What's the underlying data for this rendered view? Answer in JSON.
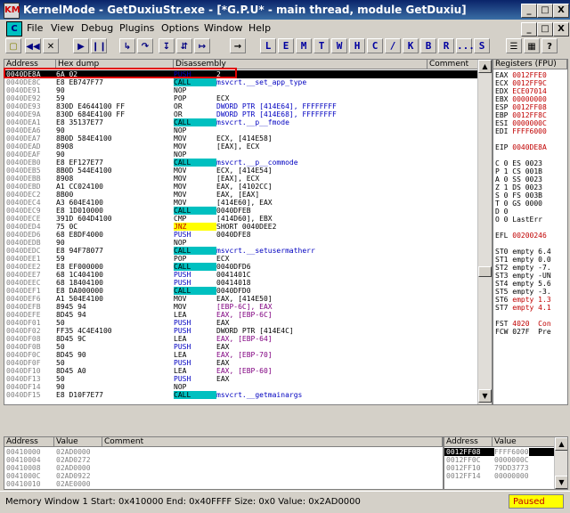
{
  "title": "KernelMode - GetDuxiuStr.exe - [*G.P.U* - main thread, module GetDuxiu]",
  "title_icon": "KM",
  "window_buttons": [
    "_",
    "□",
    "X"
  ],
  "inner_buttons": [
    "_",
    "□",
    "X"
  ],
  "menu": [
    "File",
    "View",
    "Debug",
    "Plugins",
    "Options",
    "Window",
    "Help"
  ],
  "menu_icon": "C",
  "toolbar_letters": [
    "L",
    "E",
    "M",
    "T",
    "W",
    "H",
    "C",
    "/",
    "K",
    "B",
    "R",
    "...",
    "S"
  ],
  "disasm_headers": {
    "address": "Address",
    "hex": "Hex dump",
    "disasm": "Disassembly",
    "comment": "Comment"
  },
  "disasm_rows": [
    {
      "addr": "0040DE8A",
      "hex": "6A 02",
      "op": "PUSH",
      "arg": "2",
      "kind": "push",
      "sel": true
    },
    {
      "addr": "0040DE8C",
      "hex": "E8 EB747F77",
      "op": "CALL",
      "arg": "msvcrt.__set_app_type",
      "kind": "call"
    },
    {
      "addr": "0040DE91",
      "hex": "90",
      "op": "NOP",
      "arg": "",
      "kind": ""
    },
    {
      "addr": "0040DE92",
      "hex": "59",
      "op": "POP",
      "arg": "ECX",
      "kind": ""
    },
    {
      "addr": "0040DE93",
      "hex": "830D E4644100 FF",
      "op": "OR",
      "arg": "DWORD PTR [414E64], FFFFFFFF",
      "kind": ""
    },
    {
      "addr": "0040DE9A",
      "hex": "830D 684E4100 FF",
      "op": "OR",
      "arg": "DWORD PTR [414E68], FFFFFFFF",
      "kind": ""
    },
    {
      "addr": "0040DEA1",
      "hex": "E8 35137E77",
      "op": "CALL",
      "arg": "msvcrt.__p__fmode",
      "kind": "call"
    },
    {
      "addr": "0040DEA6",
      "hex": "90",
      "op": "NOP",
      "arg": "",
      "kind": ""
    },
    {
      "addr": "0040DEA7",
      "hex": "8B0D 584E4100",
      "op": "MOV",
      "arg": "ECX, [414E58]",
      "kind": ""
    },
    {
      "addr": "0040DEAD",
      "hex": "8908",
      "op": "MOV",
      "arg": "[EAX], ECX",
      "kind": ""
    },
    {
      "addr": "0040DEAF",
      "hex": "90",
      "op": "NOP",
      "arg": "",
      "kind": ""
    },
    {
      "addr": "0040DEB0",
      "hex": "E8 EF127E77",
      "op": "CALL",
      "arg": "msvcrt.__p__commode",
      "kind": "call"
    },
    {
      "addr": "0040DEB5",
      "hex": "8B0D 544E4100",
      "op": "MOV",
      "arg": "ECX, [414E54]",
      "kind": ""
    },
    {
      "addr": "0040DEBB",
      "hex": "8908",
      "op": "MOV",
      "arg": "[EAX], ECX",
      "kind": ""
    },
    {
      "addr": "0040DEBD",
      "hex": "A1 CC024100",
      "op": "MOV",
      "arg": "EAX, [4102CC]",
      "kind": ""
    },
    {
      "addr": "0040DEC2",
      "hex": "8B00",
      "op": "MOV",
      "arg": "EAX, [EAX]",
      "kind": ""
    },
    {
      "addr": "0040DEC4",
      "hex": "A3 604E4100",
      "op": "MOV",
      "arg": "[414E60], EAX",
      "kind": ""
    },
    {
      "addr": "0040DEC9",
      "hex": "E8 1D010000",
      "op": "CALL",
      "arg": "0040DFEB",
      "kind": "call"
    },
    {
      "addr": "0040DECE",
      "hex": "391D 604D4100",
      "op": "CMP",
      "arg": "[414D60], EBX",
      "kind": ""
    },
    {
      "addr": "0040DED4",
      "hex": "75 0C",
      "op": "JNZ",
      "arg": "SHORT 0040DEE2",
      "kind": "jmp"
    },
    {
      "addr": "0040DED6",
      "hex": "68 E8DF4000",
      "op": "PUSH",
      "arg": "0040DFE8",
      "kind": "push"
    },
    {
      "addr": "0040DEDB",
      "hex": "90",
      "op": "NOP",
      "arg": "",
      "kind": ""
    },
    {
      "addr": "0040DEDC",
      "hex": "E8 94F78077",
      "op": "CALL",
      "arg": "msvcrt.__setusermatherr",
      "kind": "call"
    },
    {
      "addr": "0040DEE1",
      "hex": "59",
      "op": "POP",
      "arg": "ECX",
      "kind": ""
    },
    {
      "addr": "0040DEE2",
      "hex": "E8 EF000000",
      "op": "CALL",
      "arg": "0040DFD6",
      "kind": "call"
    },
    {
      "addr": "0040DEE7",
      "hex": "68 1C404100",
      "op": "PUSH",
      "arg": "0041401C",
      "kind": "push"
    },
    {
      "addr": "0040DEEC",
      "hex": "68 18404100",
      "op": "PUSH",
      "arg": "00414018",
      "kind": "push"
    },
    {
      "addr": "0040DEF1",
      "hex": "E8 DA000000",
      "op": "CALL",
      "arg": "0040DFD0",
      "kind": "call"
    },
    {
      "addr": "0040DEF6",
      "hex": "A1 504E4100",
      "op": "MOV",
      "arg": "EAX, [414E50]",
      "kind": ""
    },
    {
      "addr": "0040DEFB",
      "hex": "8945 94",
      "op": "MOV",
      "arg": "[EBP-6C], EAX",
      "kind": ""
    },
    {
      "addr": "0040DEFE",
      "hex": "8D45 94",
      "op": "LEA",
      "arg": "EAX, [EBP-6C]",
      "kind": ""
    },
    {
      "addr": "0040DF01",
      "hex": "50",
      "op": "PUSH",
      "arg": "EAX",
      "kind": "push"
    },
    {
      "addr": "0040DF02",
      "hex": "FF35 4C4E4100",
      "op": "PUSH",
      "arg": "DWORD PTR [414E4C]",
      "kind": "push"
    },
    {
      "addr": "0040DF08",
      "hex": "8D45 9C",
      "op": "LEA",
      "arg": "EAX, [EBP-64]",
      "kind": ""
    },
    {
      "addr": "0040DF0B",
      "hex": "50",
      "op": "PUSH",
      "arg": "EAX",
      "kind": "push"
    },
    {
      "addr": "0040DF0C",
      "hex": "8D45 90",
      "op": "LEA",
      "arg": "EAX, [EBP-70]",
      "kind": ""
    },
    {
      "addr": "0040DF0F",
      "hex": "50",
      "op": "PUSH",
      "arg": "EAX",
      "kind": "push"
    },
    {
      "addr": "0040DF10",
      "hex": "8D45 A0",
      "op": "LEA",
      "arg": "EAX, [EBP-60]",
      "kind": ""
    },
    {
      "addr": "0040DF13",
      "hex": "50",
      "op": "PUSH",
      "arg": "EAX",
      "kind": "push"
    },
    {
      "addr": "0040DF14",
      "hex": "90",
      "op": "NOP",
      "arg": "",
      "kind": ""
    },
    {
      "addr": "0040DF15",
      "hex": "E8 D10F7E77",
      "op": "CALL",
      "arg": "msvcrt.__getmainargs",
      "kind": "call"
    }
  ],
  "registers_header": "Registers (FPU)",
  "registers": [
    {
      "name": "EAX",
      "val": "0012FFE0",
      "red": true
    },
    {
      "name": "ECX",
      "val": "0012FF9C",
      "red": true
    },
    {
      "name": "EDX",
      "val": "ECE07014",
      "red": true
    },
    {
      "name": "EBX",
      "val": "00000000",
      "red": true
    },
    {
      "name": "ESP",
      "val": "0012FF08",
      "red": true
    },
    {
      "name": "EBP",
      "val": "0012FF8C",
      "red": true
    },
    {
      "name": "ESI",
      "val": "0000000C",
      "red": true
    },
    {
      "name": "EDI",
      "val": "FFFF6000",
      "red": true
    },
    {
      "name": "",
      "val": ""
    },
    {
      "name": "EIP",
      "val": "0040DE8A",
      "red": true
    },
    {
      "name": "",
      "val": ""
    },
    {
      "name": "C 0",
      "val": "ES 0023"
    },
    {
      "name": "P 1",
      "val": "CS 001B"
    },
    {
      "name": "A 0",
      "val": "SS 0023"
    },
    {
      "name": "Z 1",
      "val": "DS 0023"
    },
    {
      "name": "S 0",
      "val": "FS 003B"
    },
    {
      "name": "T 0",
      "val": "GS 0000"
    },
    {
      "name": "D 0",
      "val": ""
    },
    {
      "name": "O 0",
      "val": "LastErr"
    },
    {
      "name": "",
      "val": ""
    },
    {
      "name": "EFL",
      "val": "00200246",
      "red": true
    },
    {
      "name": "",
      "val": ""
    },
    {
      "name": "ST0",
      "val": "empty 6.4"
    },
    {
      "name": "ST1",
      "val": "empty 0.0"
    },
    {
      "name": "ST2",
      "val": "empty -7."
    },
    {
      "name": "ST3",
      "val": "empty -UN"
    },
    {
      "name": "ST4",
      "val": "empty 5.6"
    },
    {
      "name": "ST5",
      "val": "empty -3."
    },
    {
      "name": "ST6",
      "val": "empty 1.3",
      "redval": true
    },
    {
      "name": "ST7",
      "val": "empty 4.1",
      "redval": true
    },
    {
      "name": "",
      "val": ""
    },
    {
      "name": "FST",
      "val": "4020  Con",
      "redval": true
    },
    {
      "name": "FCW",
      "val": "027F  Pre"
    }
  ],
  "dump_headers": {
    "address": "Address",
    "value": "Value",
    "comment": "Comment"
  },
  "dump_rows": [
    {
      "addr": "00410000",
      "val": "02AD0000"
    },
    {
      "addr": "00410004",
      "val": "02AD0272"
    },
    {
      "addr": "00410008",
      "val": "02AD0000"
    },
    {
      "addr": "0041000C",
      "val": "02AD0922"
    },
    {
      "addr": "00410010",
      "val": "02AE0000"
    }
  ],
  "stack_headers": {
    "address": "Address",
    "value": "Value"
  },
  "stack_rows": [
    {
      "addr": "0012FF08",
      "val": "FFFF6000",
      "sel": true
    },
    {
      "addr": "0012FF0C",
      "val": "0000000C"
    },
    {
      "addr": "0012FF10",
      "val": "79DD3773"
    },
    {
      "addr": "0012FF14",
      "val": "00000000"
    }
  ],
  "status": "Memory Window 1  Start: 0x410000  End: 0x40FFFF  Size: 0x0  Value: 0x2AD0000",
  "paused": "Paused"
}
